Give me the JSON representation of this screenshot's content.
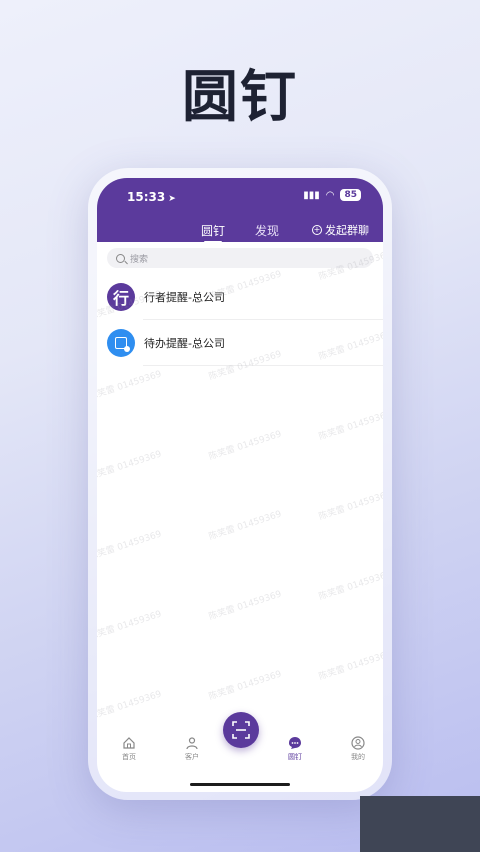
{
  "hero": {
    "title": "圆钉"
  },
  "status_bar": {
    "time": "15:33",
    "battery": "85"
  },
  "header": {
    "tabs": [
      {
        "label": "圆钉",
        "active": true
      },
      {
        "label": "发现",
        "active": false
      }
    ],
    "group_chat_label": "发起群聊"
  },
  "search": {
    "placeholder": "搜索"
  },
  "list": [
    {
      "avatar_text": "行",
      "title": "行者提醒-总公司",
      "avatar_color": "#5b3a9c"
    },
    {
      "avatar_icon": "todo-icon",
      "title": "待办提醒-总公司",
      "avatar_color": "#2f8ef0"
    }
  ],
  "watermark": "陈笑雷 01459369",
  "bottom_nav": {
    "items": [
      {
        "label": "首页",
        "icon": "home-icon"
      },
      {
        "label": "客户",
        "icon": "user-icon"
      },
      {
        "label": "圆钉",
        "icon": "chat-icon",
        "active": true
      },
      {
        "label": "我的",
        "icon": "profile-icon"
      }
    ],
    "center_icon": "scan-icon"
  },
  "colors": {
    "brand": "#5b3a9c",
    "accent_blue": "#2f8ef0"
  }
}
